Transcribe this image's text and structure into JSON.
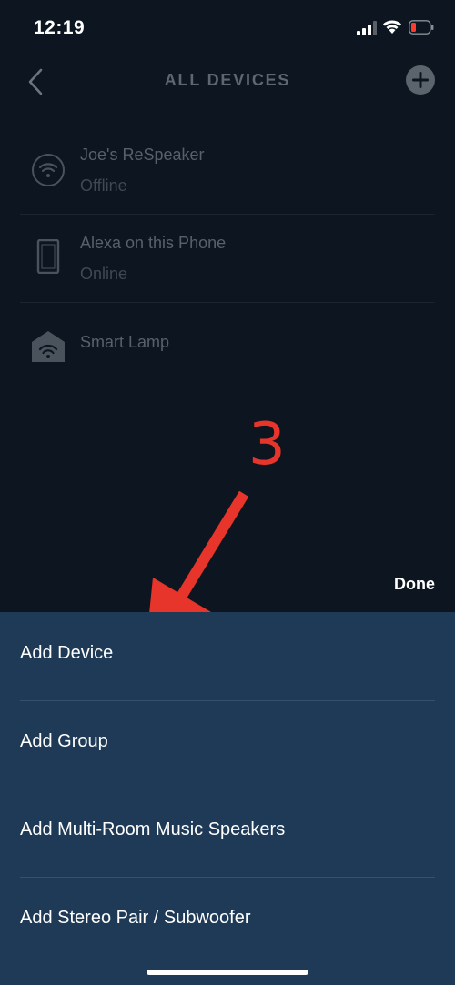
{
  "status_bar": {
    "time": "12:19"
  },
  "header": {
    "title": "ALL DEVICES"
  },
  "devices": [
    {
      "name": "Joe's ReSpeaker",
      "status": "Offline",
      "icon": "wifi-speaker-icon"
    },
    {
      "name": "Alexa on this Phone",
      "status": "Online",
      "icon": "phone-icon"
    },
    {
      "name": "Smart Lamp",
      "status": "",
      "icon": "smart-home-icon"
    }
  ],
  "annotation": {
    "number": "3",
    "color": "#e8352b"
  },
  "done_label": "Done",
  "action_sheet": {
    "items": [
      {
        "label": "Add Device"
      },
      {
        "label": "Add Group"
      },
      {
        "label": "Add Multi-Room Music Speakers"
      },
      {
        "label": "Add Stereo Pair / Subwoofer"
      }
    ]
  },
  "colors": {
    "background": "#0d1620",
    "sheet": "#1e3a56",
    "accent_red": "#e8352b"
  }
}
